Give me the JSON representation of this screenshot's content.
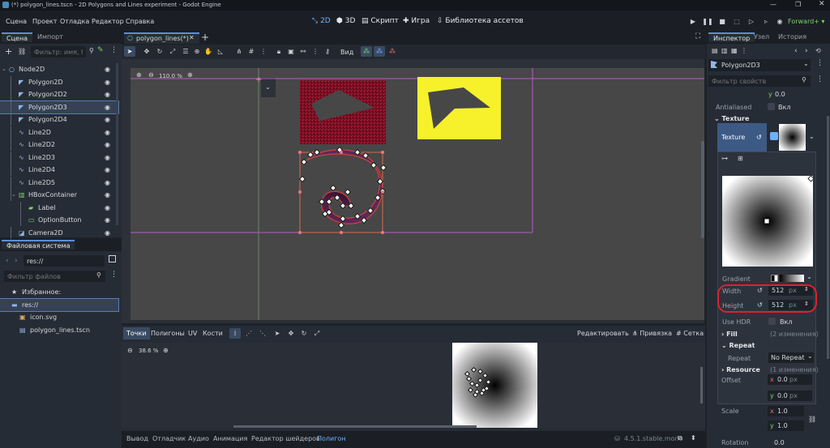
{
  "window": {
    "title": "(*) polygon_lines.tscn - 2D Polygons and Lines experiment - Godot Engine"
  },
  "menu": [
    "Сцена",
    "Проект",
    "Отладка",
    "Редактор",
    "Справка"
  ],
  "modes": {
    "m2d": "2D",
    "m3d": "3D",
    "script": "Скрипт",
    "game": "Игра",
    "assets": "Библиотека ассетов"
  },
  "renderer": "Forward+",
  "scene_dock": {
    "tabs": [
      "Сцена",
      "Импорт"
    ],
    "filter_placeholder": "Фильтр: имя, t:",
    "nodes": [
      {
        "name": "Node2D",
        "indent": 0,
        "icon": "node2d-icon"
      },
      {
        "name": "Polygon2D",
        "indent": 1,
        "icon": "polygon2d-icon"
      },
      {
        "name": "Polygon2D2",
        "indent": 1,
        "icon": "polygon2d-icon"
      },
      {
        "name": "Polygon2D3",
        "indent": 1,
        "icon": "polygon2d-icon",
        "selected": true
      },
      {
        "name": "Polygon2D4",
        "indent": 1,
        "icon": "polygon2d-icon"
      },
      {
        "name": "Line2D",
        "indent": 1,
        "icon": "line2d-icon"
      },
      {
        "name": "Line2D2",
        "indent": 1,
        "icon": "line2d-icon"
      },
      {
        "name": "Line2D3",
        "indent": 1,
        "icon": "line2d-icon"
      },
      {
        "name": "Line2D4",
        "indent": 1,
        "icon": "line2d-icon"
      },
      {
        "name": "Line2D5",
        "indent": 1,
        "icon": "line2d-icon"
      },
      {
        "name": "HBoxContainer",
        "indent": 1,
        "icon": "hbox-icon"
      },
      {
        "name": "Label",
        "indent": 2,
        "icon": "label-icon"
      },
      {
        "name": "OptionButton",
        "indent": 2,
        "icon": "optionbutton-icon"
      },
      {
        "name": "Camera2D",
        "indent": 1,
        "icon": "camera2d-icon"
      }
    ]
  },
  "fs_dock": {
    "tab": "Файловая система",
    "path": "res://",
    "filter_placeholder": "Фильтр файлов",
    "items": [
      {
        "name": "Избранное:",
        "indent": 0,
        "icon": "star-icon"
      },
      {
        "name": "res://",
        "indent": 0,
        "icon": "folder-icon",
        "selected": true
      },
      {
        "name": "icon.svg",
        "indent": 1,
        "icon": "svg-file-icon"
      },
      {
        "name": "polygon_lines.tscn",
        "indent": 1,
        "icon": "scene-file-icon"
      }
    ]
  },
  "editor": {
    "scene_tab": "polygon_lines(*)",
    "view_label": "Вид",
    "zoom": "110.0 %"
  },
  "uv_editor": {
    "tabs": [
      "Точки",
      "Полигоны",
      "UV",
      "Кости"
    ],
    "edit_label": "Редактировать",
    "snap_label": "Привязка",
    "grid_label": "Сетка",
    "zoom": "38.6 %"
  },
  "bottom_bar": {
    "tabs": [
      "Вывод",
      "Отладчик",
      "Аудио",
      "Анимация",
      "Редактор шейдеров",
      "Полигон"
    ],
    "version": "4.5.1.stable.mono"
  },
  "inspector": {
    "tabs": [
      "Инспектор",
      "Узел",
      "История"
    ],
    "node": "Polygon2D3",
    "filter_placeholder": "Фильтр свойств",
    "y_label": "y",
    "y_value": "0.0",
    "antialiased_label": "Antialiased",
    "antialiased_value": "Вкл",
    "texture_section": "Texture",
    "texture_label": "Texture",
    "gradient_label": "Gradient",
    "width_label": "Width",
    "width_value": "512",
    "height_label": "Height",
    "height_value": "512",
    "px": "px",
    "use_hdr_label": "Use HDR",
    "use_hdr_value": "Вкл",
    "fill_label": "Fill",
    "fill_changes": "(2 изменения)",
    "repeat_section": "Repeat",
    "repeat_label": "Repeat",
    "repeat_value": "No Repeat",
    "resource_label": "Resource",
    "resource_changes": "(1 изменения)",
    "offset_label": "Offset",
    "offset_x_label": "x",
    "offset_x": "0.0",
    "offset_y_label": "y",
    "offset_y": "0.0",
    "scale_label": "Scale",
    "scale_x_label": "x",
    "scale_x": "1.0",
    "scale_y_label": "y",
    "scale_y": "1.0",
    "rotation_label": "Rotation",
    "rotation_value": "0.0"
  },
  "colors": {
    "accent": "#5b8fd6",
    "highlight_ring": "#e0202e",
    "yellow_tex": "#f6f12b",
    "red_tex": "#7a0f22"
  }
}
